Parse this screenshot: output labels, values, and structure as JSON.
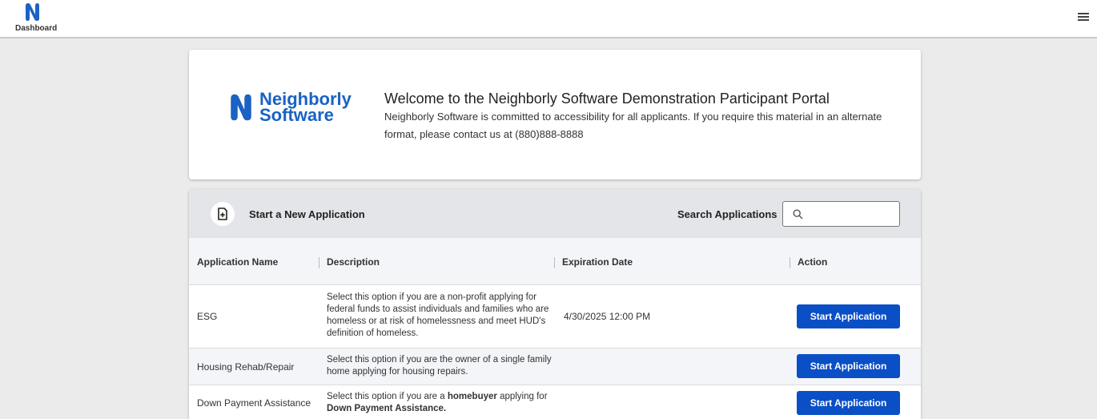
{
  "topbar": {
    "brand_label": "Dashboard",
    "menu_icon": "hamburger-menu-icon",
    "brand_color": "#1a62c4"
  },
  "welcome": {
    "logo_line1": "Neighborly",
    "logo_line2": "Software",
    "title": "Welcome to the Neighborly Software Demonstration Participant Portal",
    "description": "Neighborly Software is committed to accessibility for all applicants. If you require this material in an alternate format, please contact us at (880)888-8888"
  },
  "applications": {
    "new_label": "Start a New Application",
    "new_icon": "add-document-icon",
    "search_label": "Search Applications",
    "search_icon": "search-icon",
    "search_value": "",
    "columns": [
      "Application Name",
      "Description",
      "Expiration Date",
      "Action"
    ],
    "rows": [
      {
        "name": "ESG",
        "description": "Select this option if you are a non-profit applying for federal funds to assist individuals and families who are homeless or at risk of homelessness and meet HUD's definition of homeless.",
        "expiration": "4/30/2025 12:00 PM",
        "action": "Start Application"
      },
      {
        "name": "Housing Rehab/Repair",
        "description": "Select this option if you are the owner of a single family home applying for housing repairs.",
        "expiration": "",
        "action": "Start Application"
      },
      {
        "name": "Down Payment Assistance",
        "description_parts": [
          "Select this option if you are a ",
          "homebuyer",
          " applying for ",
          "Down Payment Assistance."
        ],
        "expiration": "",
        "action": "Start Application"
      }
    ],
    "button_color": "#0a4fc6"
  }
}
